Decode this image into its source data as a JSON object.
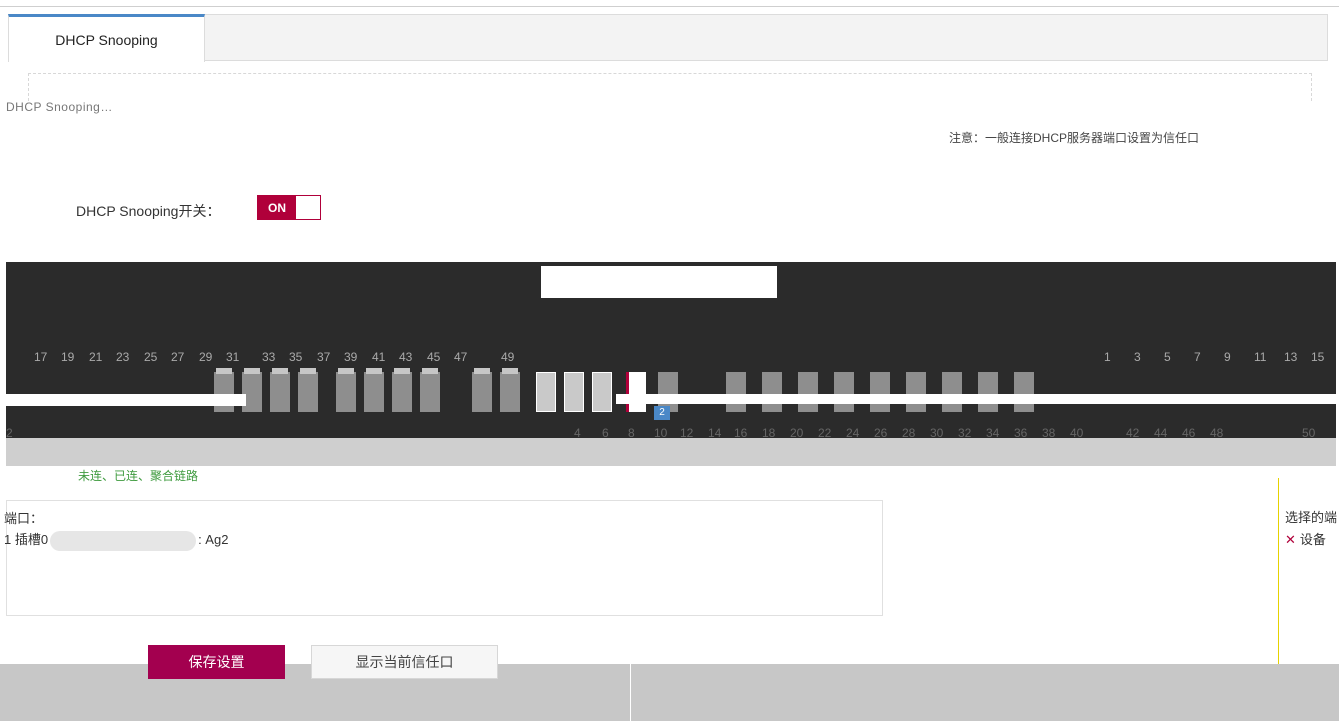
{
  "tab": {
    "label": "DHCP Snooping"
  },
  "description": "DHCP Snooping…",
  "note": {
    "text": "注意：一般连接DHCP服务器端口设置为信任口"
  },
  "switch": {
    "label": "DHCP Snooping开关：",
    "state": "ON"
  },
  "device_panel": {
    "top_numbers": [
      "17",
      "19",
      "21",
      "23",
      "25",
      "27",
      "29",
      "31",
      "33",
      "35",
      "37",
      "39",
      "41",
      "43",
      "45",
      "47",
      "49"
    ],
    "right_numbers": [
      "1",
      "3",
      "5",
      "7",
      "9",
      "11",
      "13",
      "15"
    ],
    "bottom_numbers": [
      "2",
      "4",
      "6",
      "8",
      "10",
      "12",
      "14",
      "16",
      "18",
      "20",
      "22",
      "24",
      "26",
      "28",
      "30",
      "32",
      "34",
      "36",
      "38",
      "40",
      "42",
      "44",
      "46",
      "48",
      "50"
    ],
    "badge": "2",
    "port_label_4": "4"
  },
  "legend": {
    "text": "未连、已连、聚合链路"
  },
  "ports": {
    "title": "端口：",
    "value_prefix": "1 插槽0",
    "value_suffix": ": Ag2"
  },
  "right_panel": {
    "title": "选择的端",
    "item": "设备"
  },
  "buttons": {
    "save": "保存设置",
    "show_trusted": "显示当前信任口"
  }
}
